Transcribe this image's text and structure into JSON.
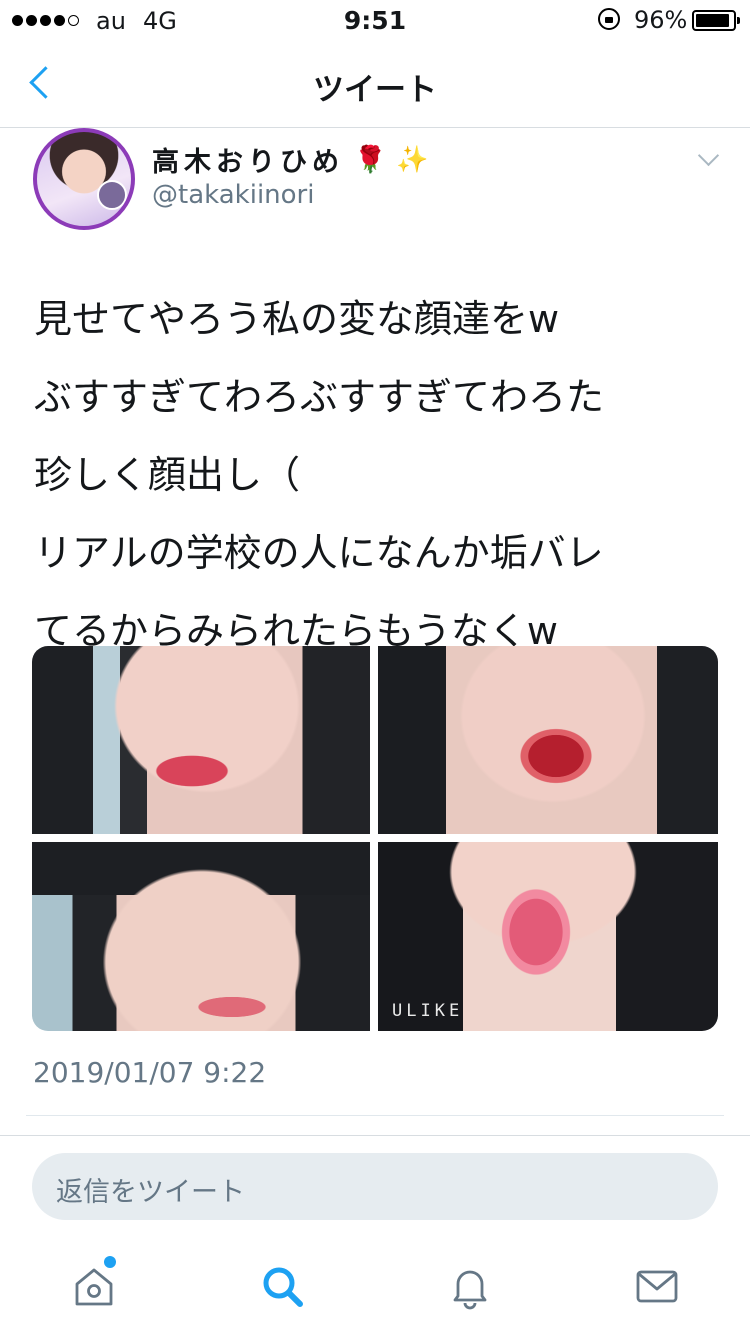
{
  "status_bar": {
    "carrier": "au",
    "network": "4G",
    "time": "9:51",
    "battery": "96%"
  },
  "nav": {
    "title": "ツイート"
  },
  "tweet": {
    "author_name": "高木おりひめ",
    "author_emoji": "🌹",
    "author_emoji2": "✨",
    "handle": "@takakiinori",
    "lines": [
      "見せてやろう私の変な顔達をw",
      "ぶすすぎてわろぶすすぎてわろた",
      "珍しく顔出し（",
      "リアルの学校の人になんか垢バレ",
      "てるからみられたらもうなくw"
    ],
    "media": {
      "count": 4,
      "watermark": "ULIKE"
    },
    "timestamp": "2019/01/07 9:22"
  },
  "reply": {
    "placeholder": "返信をツイート"
  },
  "tabbar": {
    "items": [
      "home-icon",
      "search-icon",
      "notifications-icon",
      "messages-icon"
    ],
    "accent": "#1da1f2",
    "home_has_badge": true
  },
  "colors": {
    "accent": "#1da1f2",
    "secondary_text": "#657786",
    "avatar_border": "#8c3bb8"
  }
}
